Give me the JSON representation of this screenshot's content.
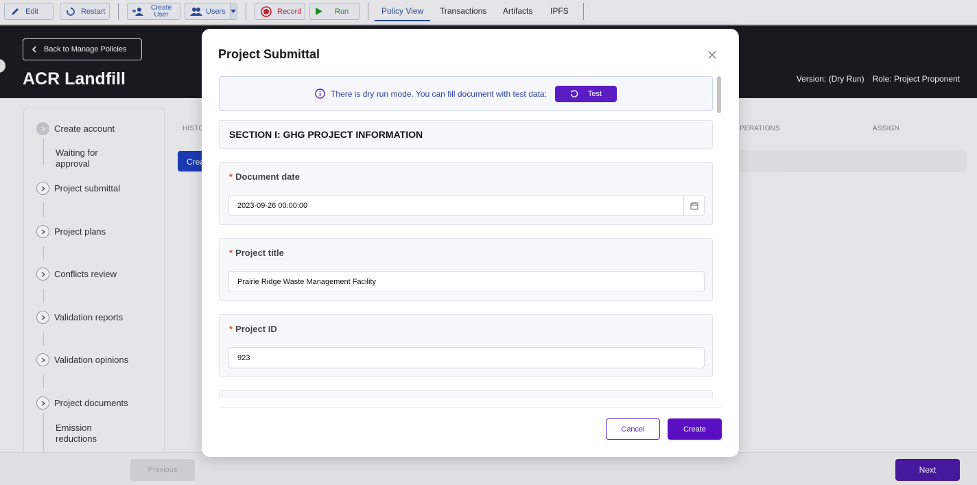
{
  "toolbar": {
    "edit_label": "Edit",
    "restart_label": "Restart",
    "create_user_line1": "Create",
    "create_user_line2": "User",
    "users_label": "Users",
    "record_label": "Record",
    "run_label": "Run",
    "tabs": [
      "Policy View",
      "Transactions",
      "Artifacts",
      "IPFS"
    ],
    "active_tab": "Policy View"
  },
  "header": {
    "back_label": "Back to Manage Policies",
    "title": "ACR Landfill",
    "version": "Version: (Dry Run)",
    "role": "Role: Project Proponent"
  },
  "steps": {
    "items": [
      {
        "label": "Create account"
      },
      {
        "label": "Waiting for approval"
      },
      {
        "label": "Project submittal"
      },
      {
        "label": "Project plans"
      },
      {
        "label": "Conflicts review"
      },
      {
        "label": "Validation reports"
      },
      {
        "label": "Validation opinions"
      },
      {
        "label": "Project documents"
      },
      {
        "label": "Emission reductions"
      }
    ]
  },
  "table": {
    "columns": [
      "HISTO",
      "PERATIONS",
      "ASSIGN"
    ],
    "create_stub": "Crea"
  },
  "footer": {
    "previous_label": "Previous",
    "next_label": "Next"
  },
  "modal": {
    "title": "Project Submittal",
    "dry_run_text": "There is dry run mode. You can fill document with test data:",
    "test_label": "Test",
    "section_title": "SECTION I: GHG PROJECT INFORMATION",
    "fields": [
      {
        "label": "Document date",
        "value": "2023-09-26 00:00:00",
        "required": true
      },
      {
        "label": "Project title",
        "value": "Prairie Ridge Waste Management Facility",
        "required": true
      },
      {
        "label": "Project ID",
        "value": "923",
        "required": true
      }
    ],
    "required_mark": "*",
    "cancel_label": "Cancel",
    "create_label": "Create"
  },
  "colors": {
    "accent": "#5b1cc4",
    "header_bg": "#1a1c22",
    "required": "#e24c2e",
    "toolbar_blue": "#3457a8"
  },
  "icons": [
    "pencil-icon",
    "restart-icon",
    "add-user-icon",
    "users-icon",
    "chevron-down-icon",
    "record-icon",
    "play-icon",
    "chevron-left-icon",
    "info-icon",
    "refresh-icon",
    "close-icon",
    "calendar-icon",
    "chevron-right-icon"
  ]
}
